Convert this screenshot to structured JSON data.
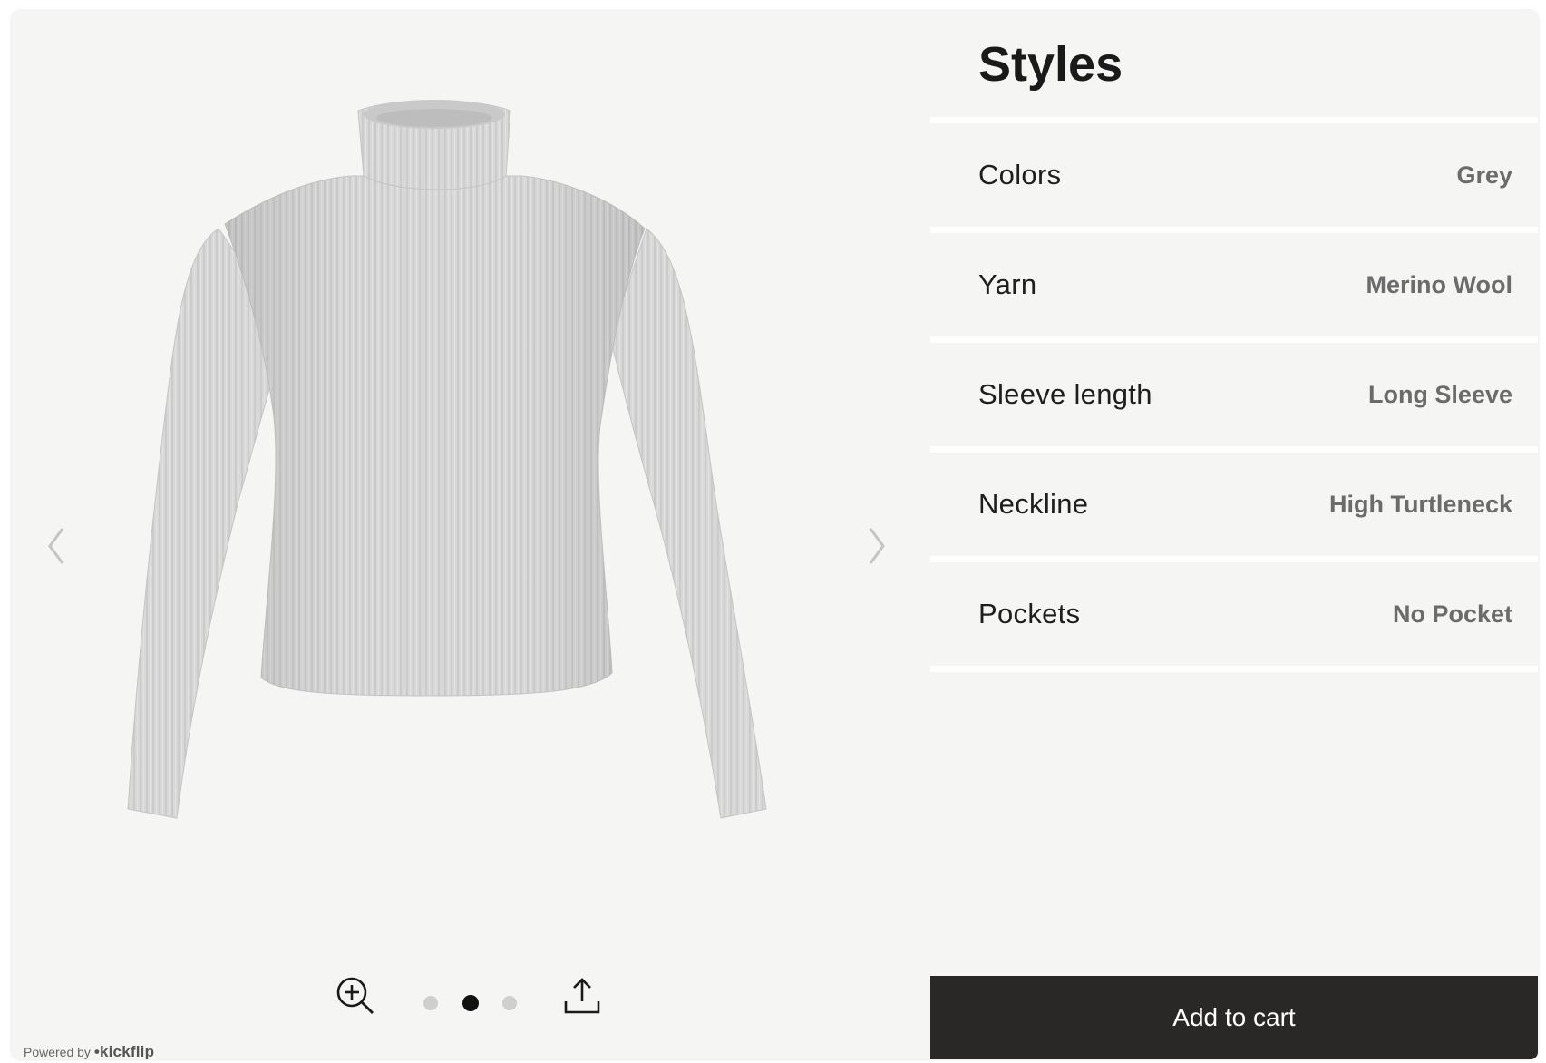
{
  "viewer": {
    "product_name": "",
    "carousel": {
      "total": 3,
      "active_index": 2
    },
    "icons": {
      "prev": "chevron-left-icon",
      "next": "chevron-right-icon",
      "zoom": "zoom-in-icon",
      "share": "share-upload-icon"
    },
    "powered_by_prefix": "Powered by",
    "powered_by_brand": "•kickflip"
  },
  "panel": {
    "title": "Styles",
    "options": [
      {
        "label": "Colors",
        "value": "Grey"
      },
      {
        "label": "Yarn",
        "value": "Merino Wool"
      },
      {
        "label": "Sleeve length",
        "value": "Long Sleeve"
      },
      {
        "label": "Neckline",
        "value": "High Turtleneck"
      },
      {
        "label": "Pockets",
        "value": "No Pocket"
      }
    ],
    "cart_label": "Add to cart"
  },
  "colors": {
    "background": "#f5f5f4",
    "cart_button": "#292826",
    "active_dot": "#111111",
    "inactive_dot": "#cfcfcf",
    "garment": "#d6d6d6"
  }
}
